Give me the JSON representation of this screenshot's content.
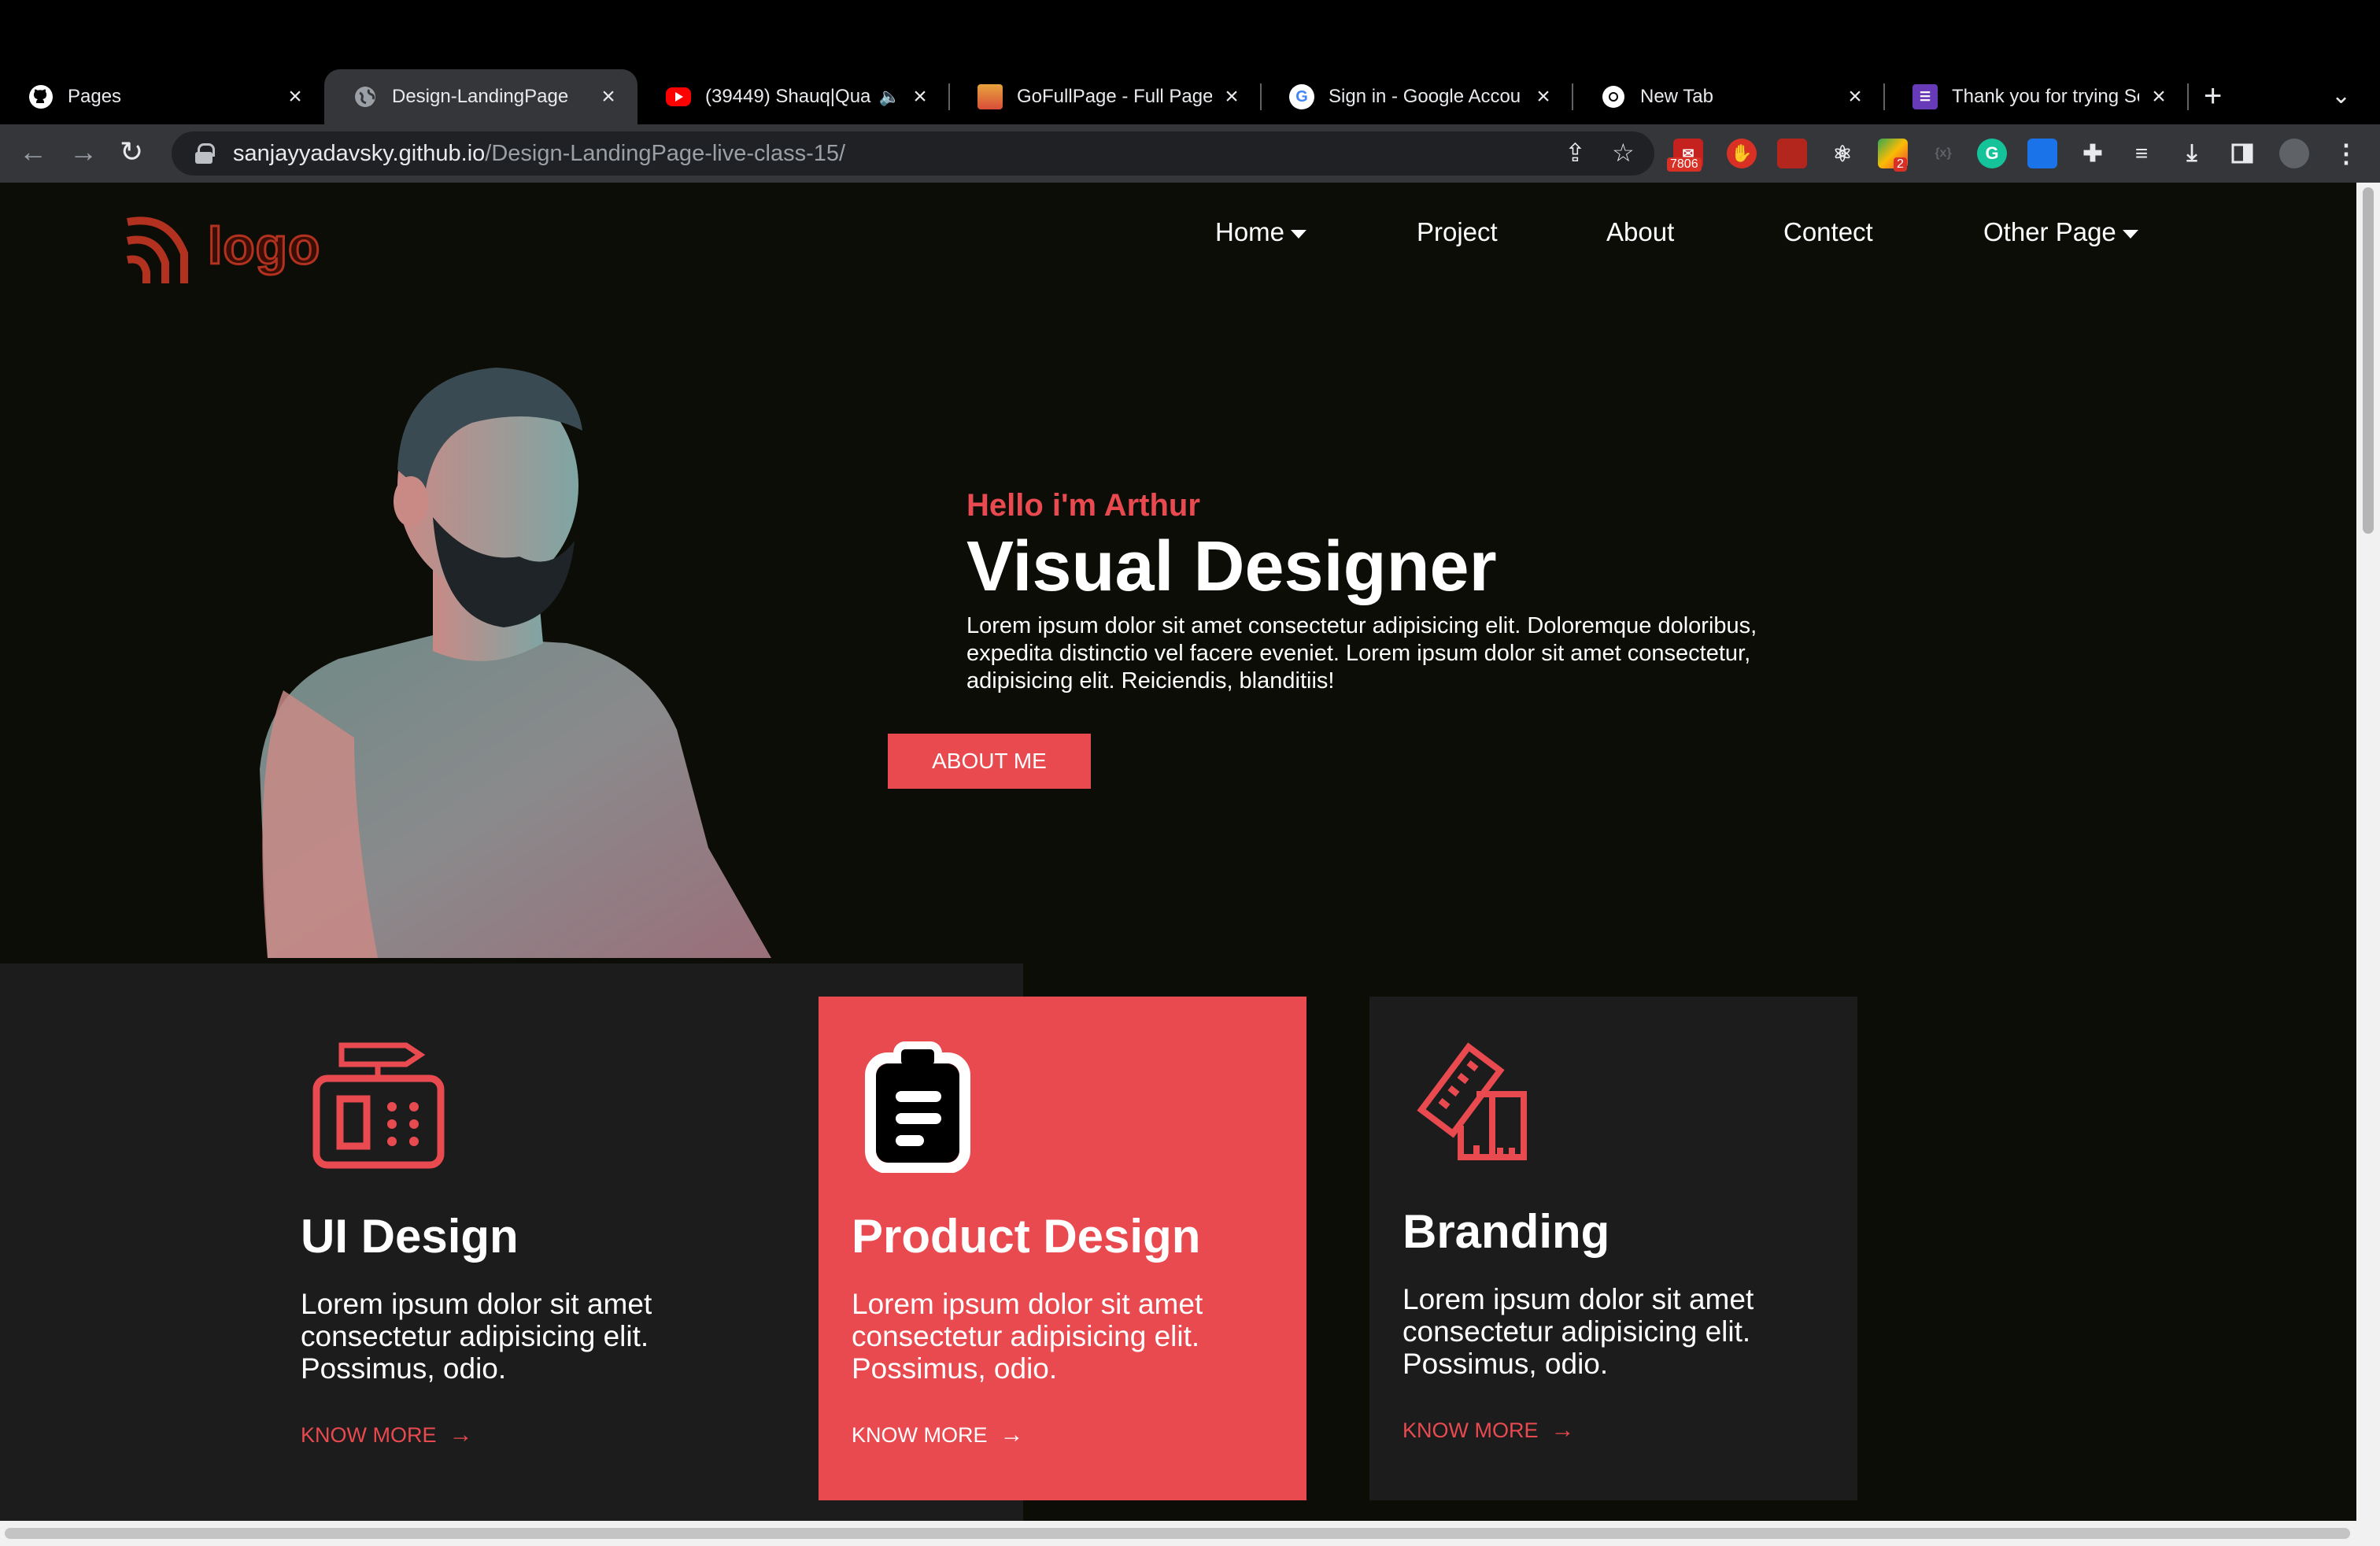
{
  "browser": {
    "tabs": [
      {
        "title": "Pages",
        "favicon": "github-icon"
      },
      {
        "title": "Design-LandingPage",
        "favicon": "globe-icon",
        "active": true
      },
      {
        "title": "(39449) Shauq|Qua",
        "favicon": "youtube-icon",
        "audio": true
      },
      {
        "title": "GoFullPage - Full Page",
        "favicon": "gofullpage-icon"
      },
      {
        "title": "Sign in - Google Accou",
        "favicon": "google-icon"
      },
      {
        "title": "New Tab",
        "favicon": "chrome-icon"
      },
      {
        "title": "Thank you for trying Se",
        "favicon": "forms-icon"
      }
    ],
    "url_host": "sanjayyadavsky.github.io",
    "url_path": "/Design-LandingPage-live-class-15/",
    "extensions": {
      "mail_badge": "7806",
      "grid_badge": "2"
    }
  },
  "site": {
    "logo_text": "logo",
    "nav": {
      "home": "Home",
      "project": "Project",
      "about": "About",
      "contect": "Contect",
      "other": "Other Page"
    },
    "hero": {
      "kicker": "Hello i'm Arthur",
      "title": "Visual Designer",
      "description": "Lorem ipsum dolor sit amet consectetur adipisicing elit. Doloremque doloribus, expedita distinctio vel facere eveniet. Lorem ipsum dolor sit amet consectetur, adipisicing elit. Reiciendis, blanditiis!",
      "button": "ABOUT ME"
    },
    "services": [
      {
        "title": "UI Design",
        "description": "Lorem ipsum dolor sit amet consectetur adipisicing elit. Possimus, odio.",
        "link": "KNOW MORE",
        "icon": "ui-design-icon"
      },
      {
        "title": "Product Design",
        "description": "Lorem ipsum dolor sit amet consectetur adipisicing elit. Possimus, odio.",
        "link": "KNOW MORE",
        "icon": "clipboard-icon"
      },
      {
        "title": "Branding",
        "description": "Lorem ipsum dolor sit amet consectetur adipisicing elit. Possimus, odio.",
        "link": "KNOW MORE",
        "icon": "ruler-icon"
      }
    ],
    "colors": {
      "accent": "#e84a4f",
      "page_bg": "#0d0d07",
      "card_bg": "#1c1c1d"
    }
  }
}
